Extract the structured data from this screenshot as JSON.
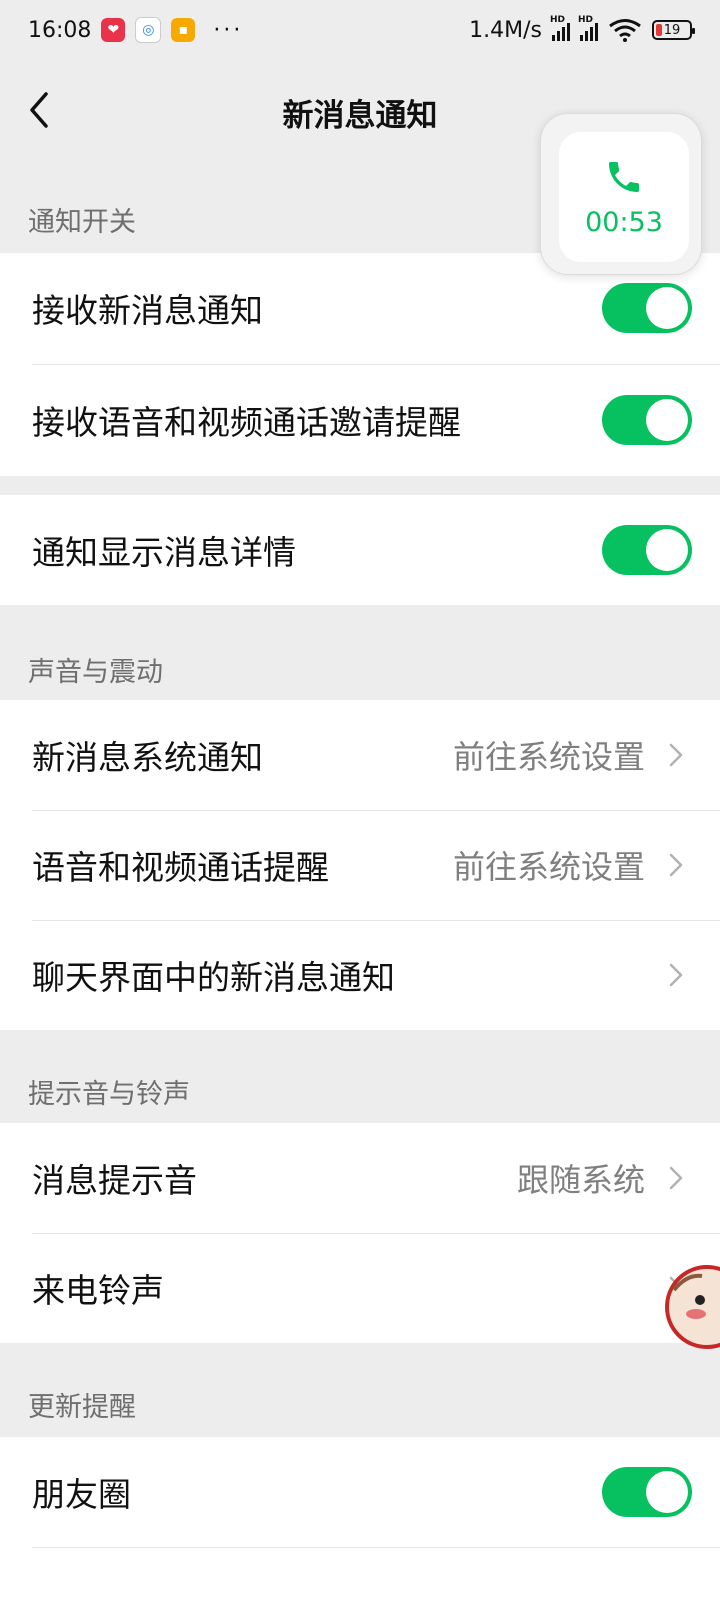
{
  "status_bar": {
    "time": "16:08",
    "network_speed": "1.4M/s",
    "dots": "···",
    "battery": "19"
  },
  "nav": {
    "title": "新消息通知"
  },
  "call_float": {
    "time": "00:53"
  },
  "sections": {
    "notify_switch": "通知开关",
    "sound_vibration": "声音与震动",
    "tone_ringtone": "提示音与铃声",
    "update_reminder": "更新提醒"
  },
  "rows": {
    "receive_new_msg": "接收新消息通知",
    "receive_call_invite": "接收语音和视频通话邀请提醒",
    "show_msg_detail": "通知显示消息详情",
    "sys_notify": "新消息系统通知",
    "sys_notify_value": "前往系统设置",
    "call_reminder": "语音和视频通话提醒",
    "call_reminder_value": "前往系统设置",
    "chat_new_msg": "聊天界面中的新消息通知",
    "msg_tone": "消息提示音",
    "msg_tone_value": "跟随系统",
    "ringtone": "来电铃声",
    "moments": "朋友圈"
  },
  "toggles": {
    "receive_new_msg": true,
    "receive_call_invite": true,
    "show_msg_detail": true,
    "moments": true
  },
  "colors": {
    "accent": "#07c160",
    "background": "#ededed",
    "card": "#ffffff",
    "secondary_text": "#7f7f7f"
  }
}
